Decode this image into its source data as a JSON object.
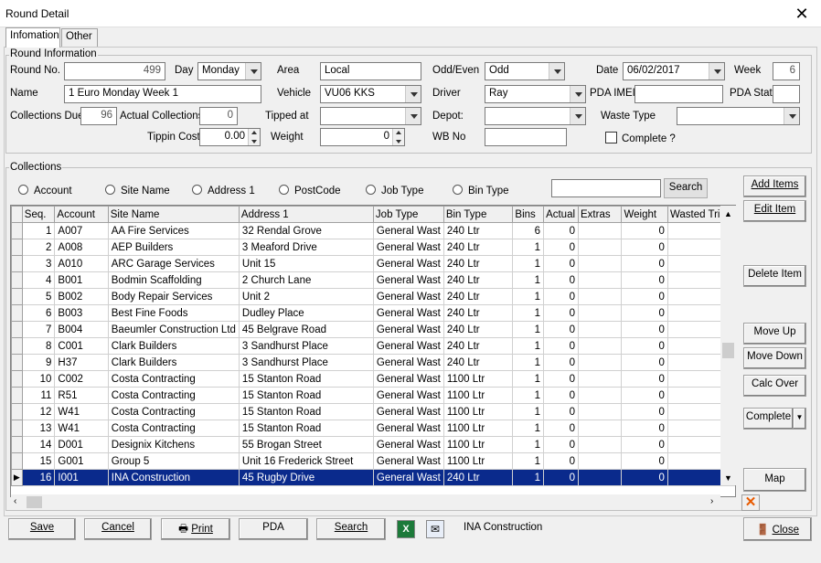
{
  "window": {
    "title": "Round Detail"
  },
  "tabs": [
    {
      "label": "Infomation"
    },
    {
      "label": "Other"
    }
  ],
  "round_info": {
    "legend": "Round Information",
    "round_no_label": "Round No.",
    "round_no": "499",
    "day_label": "Day",
    "day": "Monday",
    "area_label": "Area",
    "area": "Local",
    "odd_even_label": "Odd/Even",
    "odd_even": "Odd",
    "date_label": "Date",
    "date": "06/02/2017",
    "week_label": "Week",
    "week": "6",
    "name_label": "Name",
    "name": "1 Euro Monday Week 1",
    "vehicle_label": "Vehicle",
    "vehicle": "VU06 KKS",
    "driver_label": "Driver",
    "driver": "Ray",
    "pda_imei_label": "PDA IMEI",
    "pda_imei": "",
    "pda_stat_label": "PDA Stat",
    "pda_stat": "",
    "collections_due_label": "Collections Due",
    "collections_due": "96",
    "actual_collections_label": "Actual Collections",
    "actual_collections": "0",
    "tipped_at_label": "Tipped at",
    "tipped_at": "",
    "depot_label": "Depot:",
    "depot": "",
    "waste_type_label": "Waste Type",
    "waste_type": "",
    "tippin_cost_label": "Tippin Cost",
    "tippin_cost": "0.00",
    "weight_label": "Weight",
    "weight": "0",
    "wb_no_label": "WB No",
    "wb_no": "",
    "complete_label": "Complete ?"
  },
  "collections": {
    "legend": "Collections",
    "search_options": [
      "Account",
      "Site Name",
      "Address 1",
      "PostCode",
      "Job Type",
      "Bin Type"
    ],
    "search_value": "",
    "search_button": "Search",
    "columns": [
      "Seq.",
      "Account",
      "Site Name",
      "Address 1",
      "Job Type",
      "Bin Type",
      "Bins",
      "Actual",
      "Extras",
      "Weight",
      "Wasted Trip"
    ],
    "rows": [
      [
        "1",
        "A007",
        "AA Fire Services",
        "32 Rendal Grove",
        "General Wast",
        "240 Ltr",
        "6",
        "0",
        "",
        "0",
        ""
      ],
      [
        "2",
        "A008",
        "AEP Builders",
        "3 Meaford Drive",
        "General Wast",
        "240 Ltr",
        "1",
        "0",
        "",
        "0",
        ""
      ],
      [
        "3",
        "A010",
        "ARC Garage Services",
        "Unit 15",
        "General Wast",
        "240 Ltr",
        "1",
        "0",
        "",
        "0",
        ""
      ],
      [
        "4",
        "B001",
        "Bodmin Scaffolding",
        "2 Church Lane",
        "General Wast",
        "240 Ltr",
        "1",
        "0",
        "",
        "0",
        ""
      ],
      [
        "5",
        "B002",
        "Body Repair Services",
        "Unit 2",
        "General Wast",
        "240 Ltr",
        "1",
        "0",
        "",
        "0",
        ""
      ],
      [
        "6",
        "B003",
        "Best Fine Foods",
        "Dudley Place",
        "General Wast",
        "240 Ltr",
        "1",
        "0",
        "",
        "0",
        ""
      ],
      [
        "7",
        "B004",
        "Baeumler Construction Ltd",
        "45 Belgrave Road",
        "General Wast",
        "240 Ltr",
        "1",
        "0",
        "",
        "0",
        ""
      ],
      [
        "8",
        "C001",
        "Clark Builders",
        "3 Sandhurst Place",
        "General Wast",
        "240 Ltr",
        "1",
        "0",
        "",
        "0",
        ""
      ],
      [
        "9",
        "H37",
        "Clark Builders",
        "3 Sandhurst Place",
        "General Wast",
        "240 Ltr",
        "1",
        "0",
        "",
        "0",
        ""
      ],
      [
        "10",
        "C002",
        "Costa Contracting",
        "15 Stanton Road",
        "General Wast",
        "1100 Ltr",
        "1",
        "0",
        "",
        "0",
        ""
      ],
      [
        "11",
        "R51",
        "Costa Contracting",
        "15 Stanton Road",
        "General Wast",
        "1100 Ltr",
        "1",
        "0",
        "",
        "0",
        ""
      ],
      [
        "12",
        "W41",
        "Costa Contracting",
        "15 Stanton Road",
        "General Wast",
        "1100 Ltr",
        "1",
        "0",
        "",
        "0",
        ""
      ],
      [
        "13",
        "W41",
        "Costa Contracting",
        "15 Stanton Road",
        "General Wast",
        "1100 Ltr",
        "1",
        "0",
        "",
        "0",
        ""
      ],
      [
        "14",
        "D001",
        "Designix Kitchens",
        "55 Brogan Street",
        "General Wast",
        "1100 Ltr",
        "1",
        "0",
        "",
        "0",
        ""
      ],
      [
        "15",
        "G001",
        "Group 5",
        "Unit 16 Frederick Street",
        "General Wast",
        "1100 Ltr",
        "1",
        "0",
        "",
        "0",
        ""
      ],
      [
        "16",
        "I001",
        "INA Construction",
        "45 Rugby Drive",
        "General Wast",
        "240 Ltr",
        "1",
        "0",
        "",
        "0",
        ""
      ]
    ],
    "selected_row": 15
  },
  "side_buttons": {
    "add_items": "Add Items",
    "edit_item": "Edit Item",
    "delete_item": "Delete Item",
    "move_up": "Move Up",
    "move_down": "Move Down",
    "calc_over": "Calc Over",
    "complete": "Complete",
    "map": "Map"
  },
  "footer": {
    "save": "Save",
    "cancel": "Cancel",
    "print": "Print",
    "pda": "PDA",
    "search": "Search",
    "status_text": "INA Construction",
    "close": "Close"
  },
  "colors": {
    "selection": "#0a2a8c",
    "close_x": "#e85a00"
  }
}
